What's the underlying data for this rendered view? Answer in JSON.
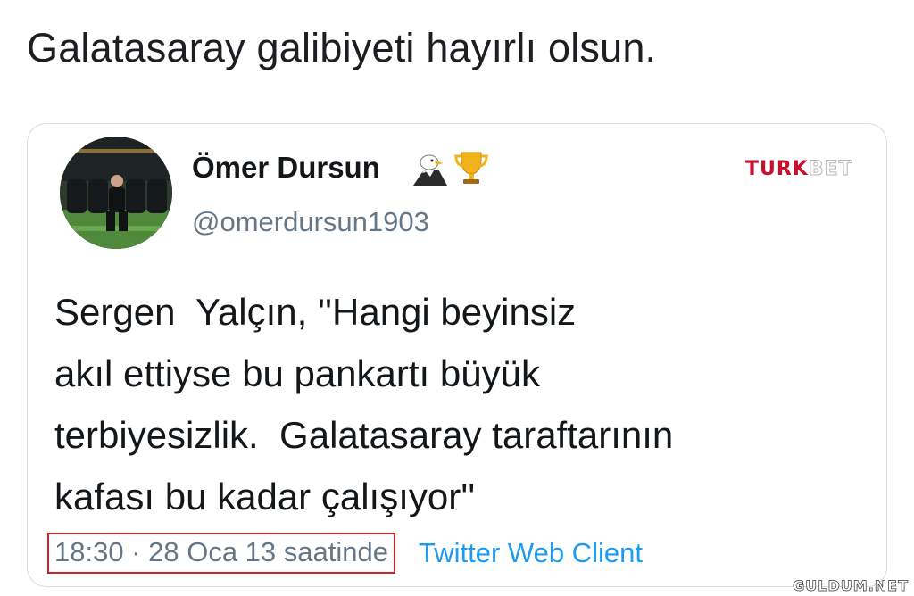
{
  "main_text": "Galatasaray galibiyeti hayırlı olsun.",
  "quoted_tweet": {
    "author_name": "Ömer Dursun",
    "name_icons": [
      "eagle-icon",
      "trophy-icon"
    ],
    "handle": "@omerdursun1903",
    "body_lines": [
      "Sergen  Yalçın, ''Hangi beyinsiz",
      "akıl ettiyse bu pankartı büyük",
      "terbiyesizlik.  Galatasaray taraftarının",
      "kafası bu kadar çalışıyor''"
    ],
    "timestamp": "18:30 · 28 Oca 13 saatinde",
    "client": "Twitter Web Client"
  },
  "watermark_top": {
    "part1": "TURK",
    "part2": "BET"
  },
  "watermark_bottom": "GULDUM.NET",
  "colors": {
    "text": "#14171a",
    "secondary": "#657786",
    "link": "#1d9bf0",
    "highlight_border": "#d0242b",
    "card_border": "#d6dbe0"
  }
}
